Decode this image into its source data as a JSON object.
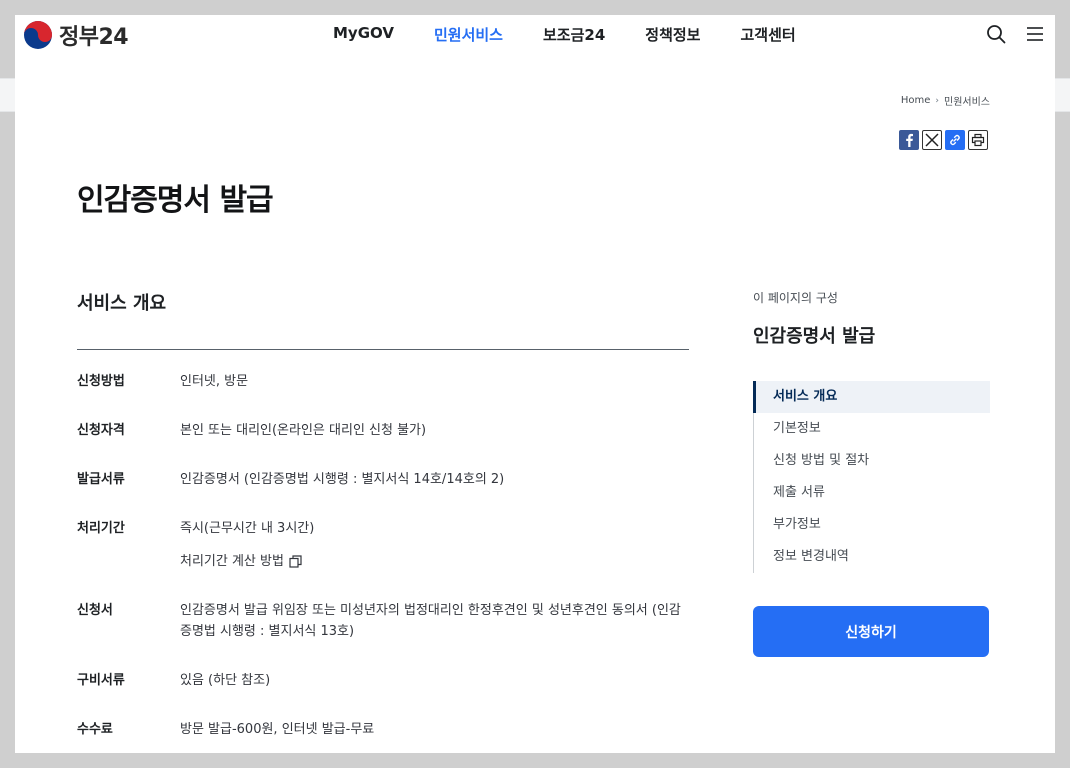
{
  "header": {
    "logo_text": "정부24",
    "nav": [
      "MyGOV",
      "민원서비스",
      "보조금24",
      "정책정보",
      "고객센터"
    ],
    "active_nav": "민원서비스",
    "icons": [
      "search-icon",
      "menu-icon"
    ]
  },
  "breadcrumb": {
    "home": "Home",
    "current": "민원서비스"
  },
  "share": [
    "facebook-icon",
    "x-icon",
    "link-icon",
    "print-icon"
  ],
  "page": {
    "title": "인감증명서 발급"
  },
  "overview": {
    "title": "서비스 개요",
    "rows": [
      {
        "label": "신청방법",
        "value": "인터넷, 방문"
      },
      {
        "label": "신청자격",
        "value": "본인 또는 대리인(온라인은 대리인 신청 불가)"
      },
      {
        "label": "발급서류",
        "value": "인감증명서 (인감증명법 시행령 : 별지서식 14호/14호의 2)"
      },
      {
        "label": "처리기간",
        "value": "즉시(근무시간 내 3시간)",
        "link": "처리기간 계산 방법"
      },
      {
        "label": "신청서",
        "value": "인감증명서 발급 위임장 또는 미성년자의 법정대리인 한정후견인 및 성년후견인 동의서 (인감증명법 시행령 : 별지서식 13호)"
      },
      {
        "label": "구비서류",
        "value": "있음 (하단 참조)"
      },
      {
        "label": "수수료",
        "value": "방문 발급-600원, 인터넷 발급-무료"
      }
    ]
  },
  "toc": {
    "caption": "이 페이지의 구성",
    "title": "인감증명서 발급",
    "items": [
      "서비스 개요",
      "기본정보",
      "신청 방법 및 절차",
      "제출 서류",
      "부가정보",
      "정보 변경내역"
    ],
    "active": "서비스 개요"
  },
  "apply_button": "신청하기",
  "colors": {
    "accent": "#256ef4",
    "toc_active": "#052b57",
    "breadcrumb_bg": "#f4f5f6"
  }
}
